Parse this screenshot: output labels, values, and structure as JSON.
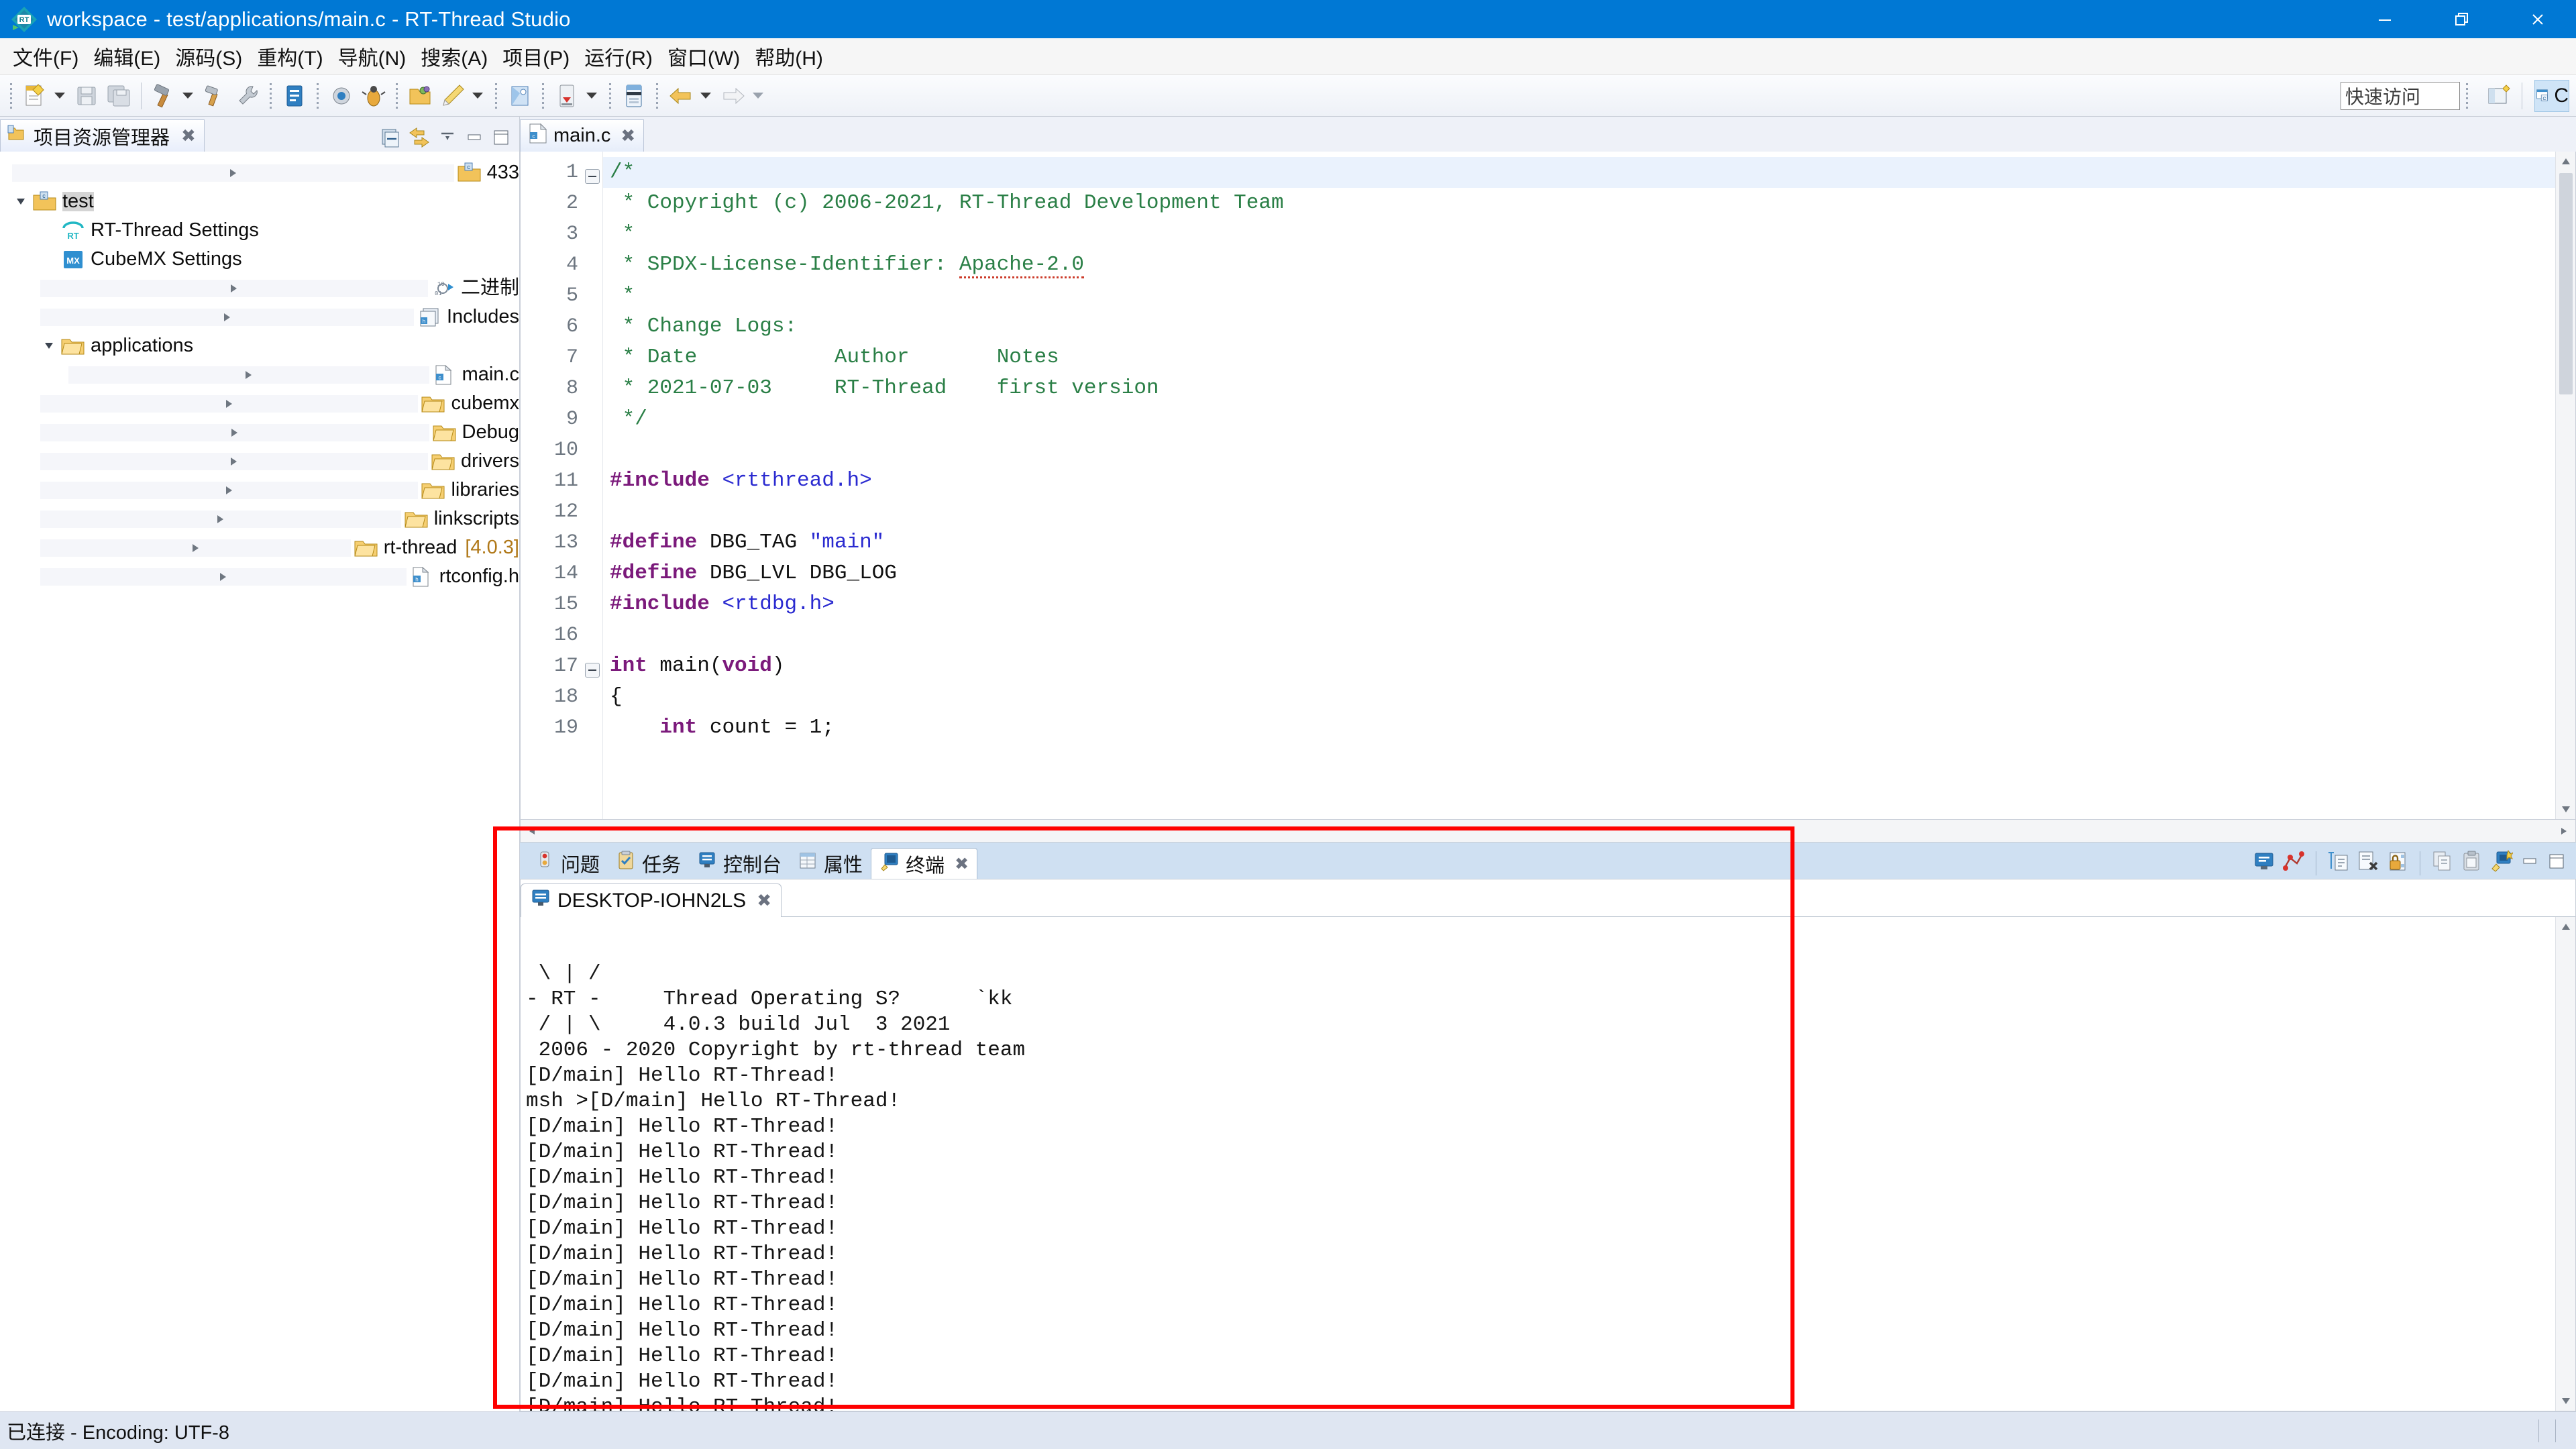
{
  "window": {
    "title": "workspace - test/applications/main.c - RT-Thread Studio",
    "logo_icon": "rt-thread-logo-icon",
    "minimize_icon": "minimize-icon",
    "restore_icon": "restore-icon",
    "close_icon": "close-icon"
  },
  "menubar": {
    "items": [
      {
        "label": "文件(F)",
        "name": "menu-file"
      },
      {
        "label": "编辑(E)",
        "name": "menu-edit"
      },
      {
        "label": "源码(S)",
        "name": "menu-source"
      },
      {
        "label": "重构(T)",
        "name": "menu-refactor"
      },
      {
        "label": "导航(N)",
        "name": "menu-navigate"
      },
      {
        "label": "搜索(A)",
        "name": "menu-search"
      },
      {
        "label": "项目(P)",
        "name": "menu-project"
      },
      {
        "label": "运行(R)",
        "name": "menu-run"
      },
      {
        "label": "窗口(W)",
        "name": "menu-window"
      },
      {
        "label": "帮助(H)",
        "name": "menu-help"
      }
    ]
  },
  "toolbar": {
    "quick_access_label": "快速访问",
    "buttons": [
      {
        "name": "new-file-button",
        "icon": "new-file-icon"
      },
      {
        "name": "save-button",
        "icon": "save-icon"
      },
      {
        "name": "save-all-button",
        "icon": "save-all-icon"
      },
      {
        "name": "build-button",
        "icon": "hammer-icon"
      },
      {
        "name": "build-config-button",
        "icon": "hammer-wrench-icon"
      },
      {
        "name": "settings-button",
        "icon": "wrench-icon"
      },
      {
        "name": "terminal-button",
        "icon": "terminal-icon"
      },
      {
        "name": "debug-button",
        "icon": "debug-bug-icon"
      },
      {
        "name": "open-project-button",
        "icon": "open-folder-icon"
      },
      {
        "name": "flash-download-button",
        "icon": "pencil-icon"
      },
      {
        "name": "package-manager-button",
        "icon": "package-icon"
      },
      {
        "name": "download-button",
        "icon": "download-arrow-icon"
      },
      {
        "name": "sdk-manager-button",
        "icon": "sdk-icon"
      },
      {
        "name": "back-button",
        "icon": "arrow-left-icon"
      },
      {
        "name": "forward-button",
        "icon": "arrow-right-icon"
      }
    ],
    "perspective_open_icon": "open-perspective-icon",
    "perspective_c_label": "C",
    "perspective_c_icon": "c-perspective-icon"
  },
  "explorer": {
    "tab_label": "项目资源管理器",
    "tab_icon": "project-explorer-icon",
    "tab_close_icon": "close-icon",
    "tools": [
      {
        "name": "collapse-all-button",
        "icon": "collapse-all-icon"
      },
      {
        "name": "link-with-editor-button",
        "icon": "link-editor-icon"
      },
      {
        "name": "view-menu-button",
        "icon": "view-menu-icon"
      },
      {
        "name": "minimize-view-button",
        "icon": "minimize-icon"
      },
      {
        "name": "maximize-view-button",
        "icon": "maximize-icon"
      }
    ],
    "tree": [
      {
        "label": "433",
        "indent": 0,
        "arrow": "right",
        "icon": "c-project-folder-icon",
        "selected": false,
        "version": ""
      },
      {
        "label": "test",
        "indent": 0,
        "arrow": "down",
        "icon": "c-project-folder-icon",
        "selected": true,
        "version": ""
      },
      {
        "label": "RT-Thread Settings",
        "indent": 1,
        "arrow": "none",
        "icon": "rt-thread-settings-icon",
        "selected": false,
        "version": ""
      },
      {
        "label": "CubeMX Settings",
        "indent": 1,
        "arrow": "none",
        "icon": "cubemx-settings-icon",
        "selected": false,
        "version": ""
      },
      {
        "label": "二进制",
        "indent": 1,
        "arrow": "right",
        "icon": "binaries-icon",
        "selected": false,
        "version": ""
      },
      {
        "label": "Includes",
        "indent": 1,
        "arrow": "right",
        "icon": "includes-icon",
        "selected": false,
        "version": ""
      },
      {
        "label": "applications",
        "indent": 1,
        "arrow": "down",
        "icon": "folder-icon",
        "selected": false,
        "version": ""
      },
      {
        "label": "main.c",
        "indent": 2,
        "arrow": "right",
        "icon": "c-file-icon",
        "selected": false,
        "version": ""
      },
      {
        "label": "cubemx",
        "indent": 1,
        "arrow": "right",
        "icon": "folder-icon",
        "selected": false,
        "version": ""
      },
      {
        "label": "Debug",
        "indent": 1,
        "arrow": "right",
        "icon": "folder-icon",
        "selected": false,
        "version": ""
      },
      {
        "label": "drivers",
        "indent": 1,
        "arrow": "right",
        "icon": "folder-icon",
        "selected": false,
        "version": ""
      },
      {
        "label": "libraries",
        "indent": 1,
        "arrow": "right",
        "icon": "folder-icon",
        "selected": false,
        "version": ""
      },
      {
        "label": "linkscripts",
        "indent": 1,
        "arrow": "right",
        "icon": "folder-icon",
        "selected": false,
        "version": ""
      },
      {
        "label": "rt-thread",
        "indent": 1,
        "arrow": "right",
        "icon": "folder-icon",
        "selected": false,
        "version": "[4.0.3]"
      },
      {
        "label": "rtconfig.h",
        "indent": 1,
        "arrow": "right",
        "icon": "h-file-icon",
        "selected": false,
        "version": ""
      }
    ]
  },
  "editor": {
    "tab_label": "main.c",
    "tab_icon": "c-file-icon",
    "tab_close_icon": "close-icon",
    "lines": [
      {
        "n": "1",
        "fold": true,
        "hl": true,
        "segs": [
          {
            "t": "/*",
            "c": "tok-c"
          }
        ]
      },
      {
        "n": "2",
        "fold": false,
        "hl": false,
        "segs": [
          {
            "t": " * Copyright (c) 2006-2021, RT-Thread Development Team",
            "c": "tok-c"
          }
        ]
      },
      {
        "n": "3",
        "fold": false,
        "hl": false,
        "segs": [
          {
            "t": " *",
            "c": "tok-c"
          }
        ]
      },
      {
        "n": "4",
        "fold": false,
        "hl": false,
        "segs": [
          {
            "t": " * SPDX-License-Identifier: ",
            "c": "tok-c"
          },
          {
            "t": "Apache-2.0",
            "c": "tok-c spell"
          }
        ]
      },
      {
        "n": "5",
        "fold": false,
        "hl": false,
        "segs": [
          {
            "t": " *",
            "c": "tok-c"
          }
        ]
      },
      {
        "n": "6",
        "fold": false,
        "hl": false,
        "segs": [
          {
            "t": " * Change Logs:",
            "c": "tok-c"
          }
        ]
      },
      {
        "n": "7",
        "fold": false,
        "hl": false,
        "segs": [
          {
            "t": " * Date           Author       Notes",
            "c": "tok-c"
          }
        ]
      },
      {
        "n": "8",
        "fold": false,
        "hl": false,
        "segs": [
          {
            "t": " * 2021-07-03     RT-Thread    first version",
            "c": "tok-c"
          }
        ]
      },
      {
        "n": "9",
        "fold": false,
        "hl": false,
        "segs": [
          {
            "t": " */",
            "c": "tok-c"
          }
        ]
      },
      {
        "n": "10",
        "fold": false,
        "hl": false,
        "segs": [
          {
            "t": "",
            "c": "tok-n"
          }
        ]
      },
      {
        "n": "11",
        "fold": false,
        "hl": false,
        "segs": [
          {
            "t": "#include ",
            "c": "tok-p"
          },
          {
            "t": "<rtthread.h>",
            "c": "tok-s"
          }
        ]
      },
      {
        "n": "12",
        "fold": false,
        "hl": false,
        "segs": [
          {
            "t": "",
            "c": "tok-n"
          }
        ]
      },
      {
        "n": "13",
        "fold": false,
        "hl": false,
        "segs": [
          {
            "t": "#define ",
            "c": "tok-p"
          },
          {
            "t": "DBG_TAG ",
            "c": "tok-n"
          },
          {
            "t": "\"main\"",
            "c": "tok-s"
          }
        ]
      },
      {
        "n": "14",
        "fold": false,
        "hl": false,
        "segs": [
          {
            "t": "#define ",
            "c": "tok-p"
          },
          {
            "t": "DBG_LVL DBG_LOG",
            "c": "tok-n"
          }
        ]
      },
      {
        "n": "15",
        "fold": false,
        "hl": false,
        "segs": [
          {
            "t": "#include ",
            "c": "tok-p"
          },
          {
            "t": "<rtdbg.h>",
            "c": "tok-s"
          }
        ]
      },
      {
        "n": "16",
        "fold": false,
        "hl": false,
        "segs": [
          {
            "t": "",
            "c": "tok-n"
          }
        ]
      },
      {
        "n": "17",
        "fold": true,
        "hl": false,
        "segs": [
          {
            "t": "int ",
            "c": "tok-k"
          },
          {
            "t": "main(",
            "c": "tok-n"
          },
          {
            "t": "void",
            "c": "tok-k"
          },
          {
            "t": ")",
            "c": "tok-n"
          }
        ]
      },
      {
        "n": "18",
        "fold": false,
        "hl": false,
        "segs": [
          {
            "t": "{",
            "c": "tok-n"
          }
        ]
      },
      {
        "n": "19",
        "fold": false,
        "hl": false,
        "segs": [
          {
            "t": "    int",
            "c": "tok-k"
          },
          {
            "t": " count = 1;",
            "c": "tok-n"
          }
        ]
      }
    ]
  },
  "bottom_panel": {
    "tabs": [
      {
        "label": "问题",
        "icon": "problems-icon",
        "active": false,
        "name": "tab-problems"
      },
      {
        "label": "任务",
        "icon": "tasks-icon",
        "active": false,
        "name": "tab-tasks"
      },
      {
        "label": "控制台",
        "icon": "console-icon",
        "active": false,
        "name": "tab-console"
      },
      {
        "label": "属性",
        "icon": "properties-icon",
        "active": false,
        "name": "tab-properties"
      },
      {
        "label": "终端",
        "icon": "terminal-icon",
        "active": true,
        "name": "tab-terminal"
      }
    ],
    "tab_close_icon": "close-icon",
    "tools": [
      {
        "name": "open-terminal-button",
        "icon": "open-terminal-icon"
      },
      {
        "name": "pin-terminal-button",
        "icon": "pin-terminal-icon"
      },
      {
        "name": "new-terminal-button",
        "icon": "new-terminal-icon"
      },
      {
        "name": "clear-terminal-button",
        "icon": "clear-terminal-icon"
      },
      {
        "name": "lock-scroll-button",
        "icon": "lock-icon"
      },
      {
        "name": "copy-button",
        "icon": "copy-icon"
      },
      {
        "name": "paste-button",
        "icon": "paste-icon"
      },
      {
        "name": "select-terminal-button",
        "icon": "select-terminal-icon"
      },
      {
        "name": "minimize-panel-button",
        "icon": "minimize-icon"
      },
      {
        "name": "maximize-panel-button",
        "icon": "maximize-icon"
      }
    ]
  },
  "terminal": {
    "tab_label": "DESKTOP-IOHN2LS",
    "tab_icon": "terminal-screen-icon",
    "tab_close_icon": "close-icon",
    "lines": [
      "",
      " \\ | /",
      "- RT -     Thread Operating S?      `kk",
      " / | \\     4.0.3 build Jul  3 2021",
      " 2006 - 2020 Copyright by rt-thread team",
      "[D/main] Hello RT-Thread!",
      "msh >[D/main] Hello RT-Thread!",
      "[D/main] Hello RT-Thread!",
      "[D/main] Hello RT-Thread!",
      "[D/main] Hello RT-Thread!",
      "[D/main] Hello RT-Thread!",
      "[D/main] Hello RT-Thread!",
      "[D/main] Hello RT-Thread!",
      "[D/main] Hello RT-Thread!",
      "[D/main] Hello RT-Thread!",
      "[D/main] Hello RT-Thread!",
      "[D/main] Hello RT-Thread!",
      "[D/main] Hello RT-Thread!",
      "[D/main] Hello RT-Thread!"
    ]
  },
  "statusbar": {
    "text": "已连接 - Encoding: UTF-8"
  },
  "colors": {
    "title_bar": "#0078d4",
    "highlight_box": "#fe0000",
    "selection": "#d4d4d4",
    "comment": "#2a7f46",
    "preprocessor": "#7b1a7b",
    "string": "#2a2ad0"
  }
}
